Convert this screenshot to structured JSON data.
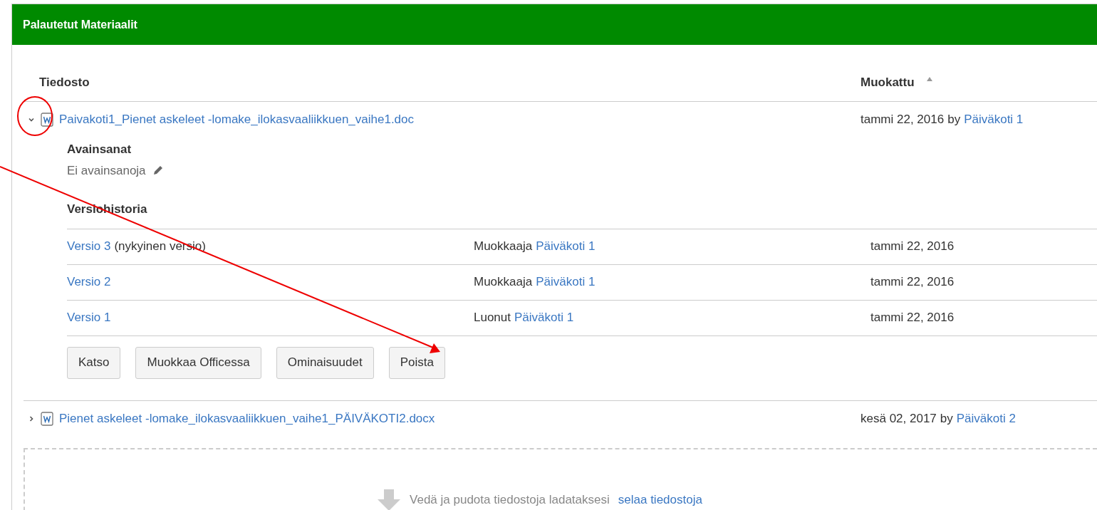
{
  "panel": {
    "title": "Palautetut Materiaalit"
  },
  "columns": [
    {
      "label": "Tiedosto"
    },
    {
      "label": "Muokattu",
      "sorted": true
    }
  ],
  "files": [
    {
      "name": "Paivakoti1_Pienet askeleet -lomake_ilokasvaaliikkuen_vaihe1.doc",
      "expanded": true,
      "date": "tammi 22, 2016",
      "by": "by",
      "author": "Päiväkoti 1",
      "details": {
        "keywords_heading": "Avainsanat",
        "keywords_value": "Ei avainsanoja",
        "versions_heading": "Versiohistoria",
        "versions": [
          {
            "label": "Versio 3",
            "note": "(nykyinen versio)",
            "action": "Muokkaaja",
            "author": "Päiväkoti 1",
            "date": "tammi 22, 2016"
          },
          {
            "label": "Versio 2",
            "action": "Muokkaaja",
            "author": "Päiväkoti 1",
            "date": "tammi 22, 2016"
          },
          {
            "label": "Versio 1",
            "action": "Luonut",
            "author": "Päiväkoti 1",
            "date": "tammi 22, 2016"
          }
        ],
        "buttons": [
          "Katso",
          "Muokkaa Officessa",
          "Ominaisuudet",
          "Poista"
        ]
      }
    },
    {
      "name": "Pienet askeleet -lomake_ilokasvaaliikkuen_vaihe1_PÄIVÄKOTI2.docx",
      "expanded": false,
      "date": "kesä 02, 2017",
      "by": "by",
      "author": "Päiväkoti 2"
    }
  ],
  "dropzone": {
    "text": "Vedä ja pudota tiedostoja ladataksesi",
    "link": "selaa tiedostoja"
  }
}
